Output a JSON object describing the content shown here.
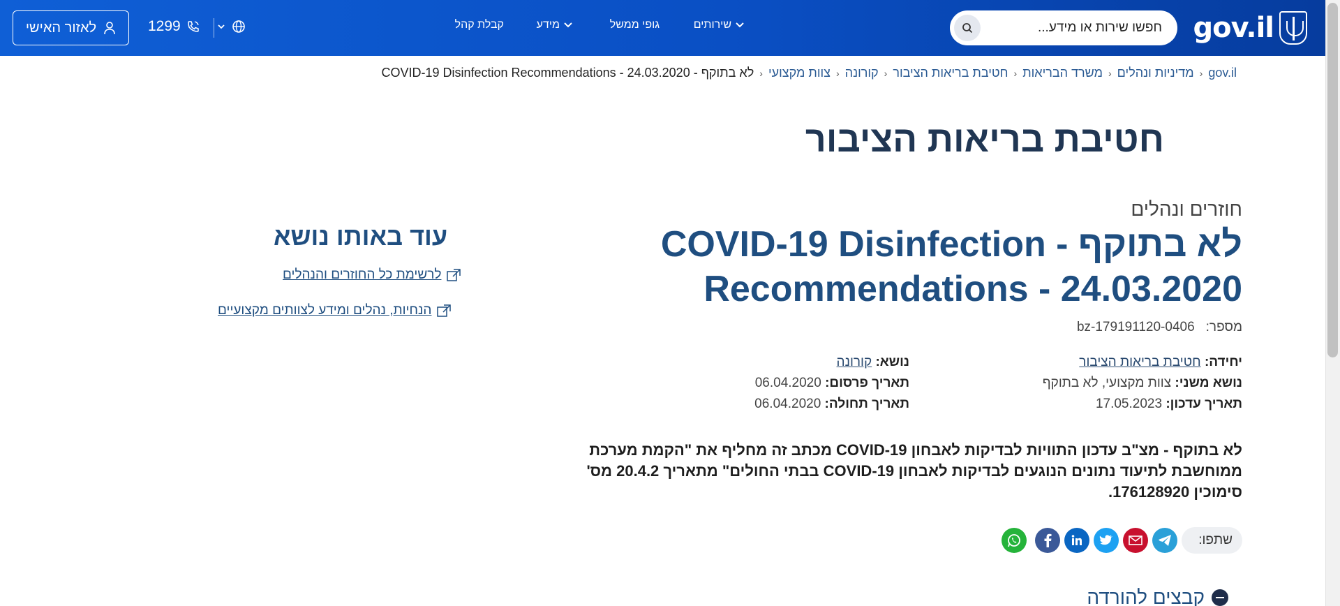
{
  "header": {
    "logo_text": "gov.il",
    "search_placeholder": "חפשו שירות או מידע...",
    "nav": {
      "services": "שירותים",
      "gov_bodies": "גופי ממשל",
      "info": "מידע",
      "reception": "קבלת קהל"
    },
    "phone": "1299",
    "personal_area": "לאזור האישי"
  },
  "breadcrumb": [
    "gov.il",
    "מדיניות ונהלים",
    "משרד הבריאות",
    "חטיבת בריאות הציבור",
    "קורונה",
    "צוות מקצועי",
    "לא בתוקף - COVID-19 Disinfection Recommendations - 24.03.2020"
  ],
  "unit_title": "חטיבת בריאות הציבור",
  "document": {
    "category": "חוזרים ונהלים",
    "title": "לא בתוקף - COVID-19 Disinfection Recommendations - 24.03.2020",
    "number_label": "מספר:",
    "number": "bz-179191120-0406",
    "unit_label": "יחידה:",
    "unit": "חטיבת בריאות הציבור",
    "subtopic_label": "נושא משני:",
    "subtopic": "צוות מקצועי, לא בתוקף",
    "updated_label": "תאריך עדכון:",
    "updated": "17.05.2023",
    "topic_label": "נושא:",
    "topic": "קורונה",
    "published_label": "תאריך פרסום:",
    "published": "06.04.2020",
    "effective_label": "תאריך תחולה:",
    "effective": "06.04.2020",
    "summary": "לא בתוקף - מצ\"ב עדכון התוויות לבדיקות לאבחון COVID-19 מכתב זה מחליף את \"הקמת מערכת ממוחשבת לתיעוד נתונים הנוגעים לבדיקות לאבחון COVID-19 בבתי החולים\" מתאריך 20.4.2 מס' סימוכין 176128920.",
    "share_label": "שתפו:",
    "download_label": "קבצים להורדה"
  },
  "related": {
    "title": "עוד באותו נושא",
    "links": [
      "לרשימת כל החוזרים והנהלים",
      "הנחיות, נהלים ומידע לצוותים מקצועיים"
    ]
  },
  "colors": {
    "header_blue": "#0a4fc4",
    "title_blue": "#1f4e80",
    "telegram": "#2aa0d8",
    "email": "#c8102e",
    "twitter": "#1da1f2",
    "linkedin": "#0a66c2",
    "facebook": "#3b5998",
    "whatsapp": "#25b33a"
  }
}
